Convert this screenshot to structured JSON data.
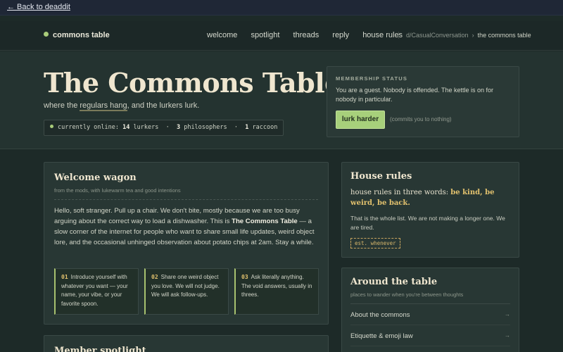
{
  "topbar": {
    "back_label": "← Back to deaddit"
  },
  "nav": {
    "brand": "commons table",
    "links": [
      "welcome",
      "spotlight",
      "threads",
      "reply",
      "house rules"
    ],
    "breadcrumb": {
      "parent": "d/CasualConversation",
      "sep": "›",
      "current": "the commons table"
    }
  },
  "hero": {
    "title": "The Commons Table",
    "tagline_a": "where the ",
    "tagline_hl": "regulars hang",
    "tagline_b": ", and the lurkers lurk.",
    "online": {
      "prefix": "currently online:",
      "lurkers_n": "14",
      "lurkers_l": "lurkers",
      "phil_n": "3",
      "phil_l": "philosophers",
      "rac_n": "1",
      "rac_l": "raccoon",
      "sep": "·"
    }
  },
  "membership": {
    "label": "MEMBERSHIP STATUS",
    "text": "You are a guest. Nobody is offended. The kettle is on for nobody in particular.",
    "button": "lurk harder",
    "note": "(commits you to nothing)"
  },
  "welcome": {
    "title": "Welcome wagon",
    "subtitle": "from the mods, with lukewarm tea and good intentions",
    "body_a": "Hello, soft stranger. Pull up a chair. We don't bite, mostly because we are too busy arguing about the correct way to load a dishwasher. This is ",
    "body_b": "The Commons Table",
    "body_c": " — a slow corner of the internet for people who want to share small life updates, weird object lore, and the occasional unhinged observation about potato chips at 2am. Stay a while.",
    "steps": [
      {
        "n": "01",
        "text": "Introduce yourself with whatever you want — your name, your vibe, or your favorite spoon."
      },
      {
        "n": "02",
        "text": "Share one weird object you love. We will not judge. We will ask follow-ups."
      },
      {
        "n": "03",
        "text": "Ask literally anything. The void answers, usually in threes."
      }
    ]
  },
  "spotlight": {
    "title": "Member spotlight"
  },
  "rules": {
    "title": "House rules",
    "lead": "house rules in three words: ",
    "highlight": "be kind, be weird, be back.",
    "small": "That is the whole list. We are not making a longer one. We are tired.",
    "tag": "est. whenever"
  },
  "around": {
    "title": "Around the table",
    "subtitle": "places to wander when you're between thoughts",
    "links": [
      "About the commons",
      "Etiquette & emoji law"
    ],
    "arrow": "→"
  }
}
